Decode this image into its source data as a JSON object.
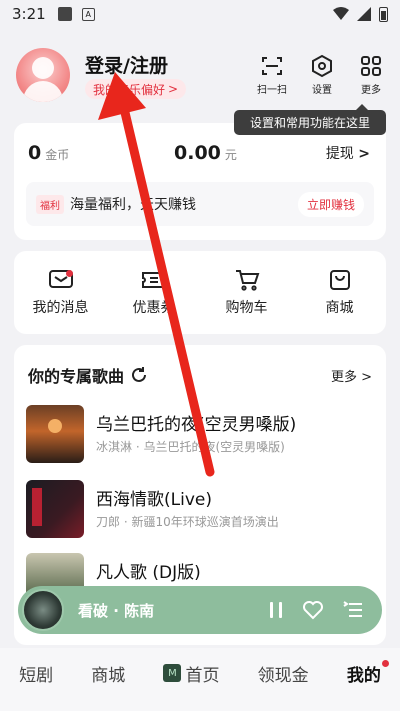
{
  "status_bar": {
    "time": "3:21",
    "a_label": "A"
  },
  "header": {
    "login_title": "登录/注册",
    "preference_label": "我的音乐偏好",
    "preference_chevron": ">",
    "scan_label": "扫一扫",
    "settings_label": "设置",
    "more_label": "更多"
  },
  "tooltip": {
    "text": "设置和常用功能在这里"
  },
  "wallet": {
    "coins_value": "0",
    "coins_unit": "金币",
    "money_value": "0.00",
    "money_unit": "元",
    "withdraw_label": "提现",
    "withdraw_chevron": ">",
    "welfare_tag": "福利",
    "welfare_text": "海量福利，天天赚钱",
    "earn_button": "立即赚钱"
  },
  "quick_actions": [
    {
      "label": "我的消息",
      "icon": "message-icon"
    },
    {
      "label": "优惠券",
      "icon": "coupon-icon"
    },
    {
      "label": "购物车",
      "icon": "cart-icon"
    },
    {
      "label": "商城",
      "icon": "shop-bag-icon"
    }
  ],
  "songs": {
    "title": "你的专属歌曲",
    "more_label": "更多",
    "more_chevron": ">",
    "items": [
      {
        "title": "乌兰巴托的夜(空灵男嗓版)",
        "subtitle": "冰淇淋 · 乌兰巴托的夜(空灵男嗓版)"
      },
      {
        "title": "西海情歌(Live)",
        "subtitle": "刀郎 · 新疆10年环球巡演首场演出"
      },
      {
        "title": "凡人歌 (DJ版)",
        "subtitle": ""
      }
    ]
  },
  "player": {
    "now_playing": "看破 · 陈南"
  },
  "tabbar": {
    "items": [
      {
        "label": "短剧"
      },
      {
        "label": "商城"
      },
      {
        "label": "首页"
      },
      {
        "label": "领现金"
      },
      {
        "label": "我的"
      }
    ]
  },
  "colors": {
    "accent_red": "#e2313f",
    "player_green": "#8ebd9d",
    "annotation_arrow": "#e8261c"
  }
}
